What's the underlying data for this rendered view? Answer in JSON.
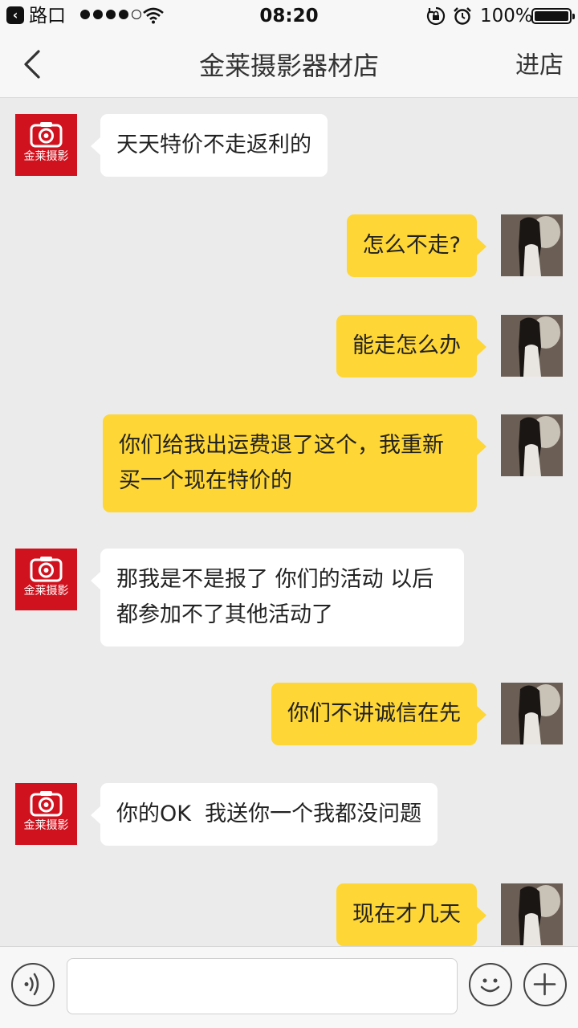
{
  "status_bar": {
    "carrier": "路口",
    "time": "08:20",
    "battery": "100%"
  },
  "nav": {
    "title": "金莱摄影器材店",
    "enter_label": "进店"
  },
  "shop_logo_text": "金莱摄影",
  "messages": [
    {
      "sender": "shop",
      "text": "天天特价不走返利的"
    },
    {
      "sender": "user",
      "text": "怎么不走?"
    },
    {
      "sender": "user",
      "text": "能走怎么办"
    },
    {
      "sender": "user",
      "text": "你们给我出运费退了这个，我重新买一个现在特价的"
    },
    {
      "sender": "shop",
      "text": "那我是不是报了 你们的活动 以后都参加不了其他活动了"
    },
    {
      "sender": "user",
      "text": "你们不讲诚信在先"
    },
    {
      "sender": "shop",
      "text": "你的OK  我送你一个我都没问题"
    },
    {
      "sender": "user",
      "text": "现在才几天"
    }
  ],
  "input": {
    "value": "",
    "placeholder": ""
  },
  "colors": {
    "user_bubble": "#fed635",
    "shop_bubble": "#ffffff",
    "shop_avatar": "#d0121e",
    "background": "#ebebeb"
  }
}
